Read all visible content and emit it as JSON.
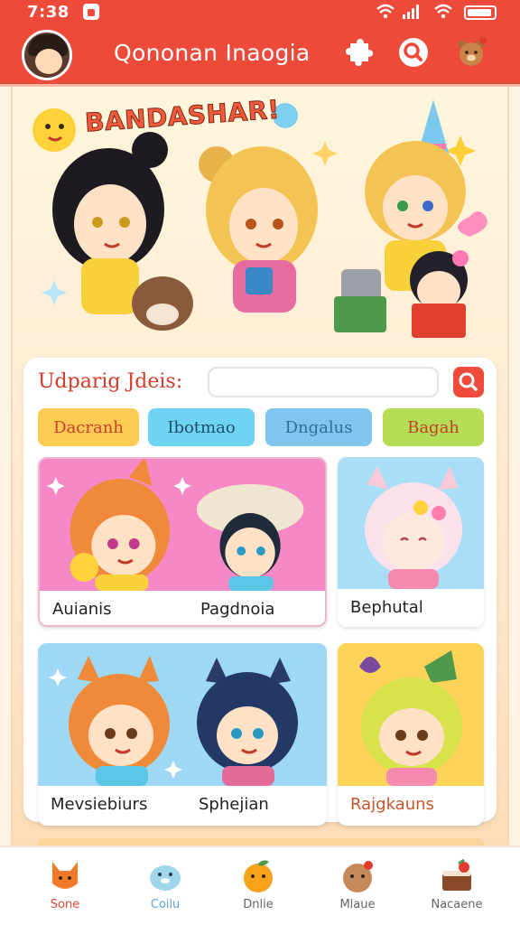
{
  "status_bar": {
    "time": "7:38"
  },
  "header": {
    "title": "Qononan Inaogia"
  },
  "hero": {
    "title": "BANDASHAR!"
  },
  "search": {
    "label": "Udparig Jdeis:",
    "placeholder": ""
  },
  "chips": [
    {
      "label": "Dacranh"
    },
    {
      "label": "Ibotmao"
    },
    {
      "label": "Dngalus"
    },
    {
      "label": "Bagah"
    }
  ],
  "cards": [
    {
      "names": [
        "Auianis",
        "Pagdnoia"
      ]
    },
    {
      "names": [
        "Bephutal"
      ]
    },
    {
      "names": [
        "Mevsiebiurs",
        "Sphejian"
      ]
    },
    {
      "names": [
        "Rajgkauns"
      ]
    }
  ],
  "bottom_nav": [
    {
      "label": "Sone",
      "icon": "fox-icon"
    },
    {
      "label": "Coilu",
      "icon": "seal-icon"
    },
    {
      "label": "Dnlie",
      "icon": "orange-icon"
    },
    {
      "label": "Mlaue",
      "icon": "cookie-icon"
    },
    {
      "label": "Nacaene",
      "icon": "cake-icon"
    }
  ],
  "colors": {
    "accent": "#ee4a3a",
    "background": "#fdf3e2"
  }
}
